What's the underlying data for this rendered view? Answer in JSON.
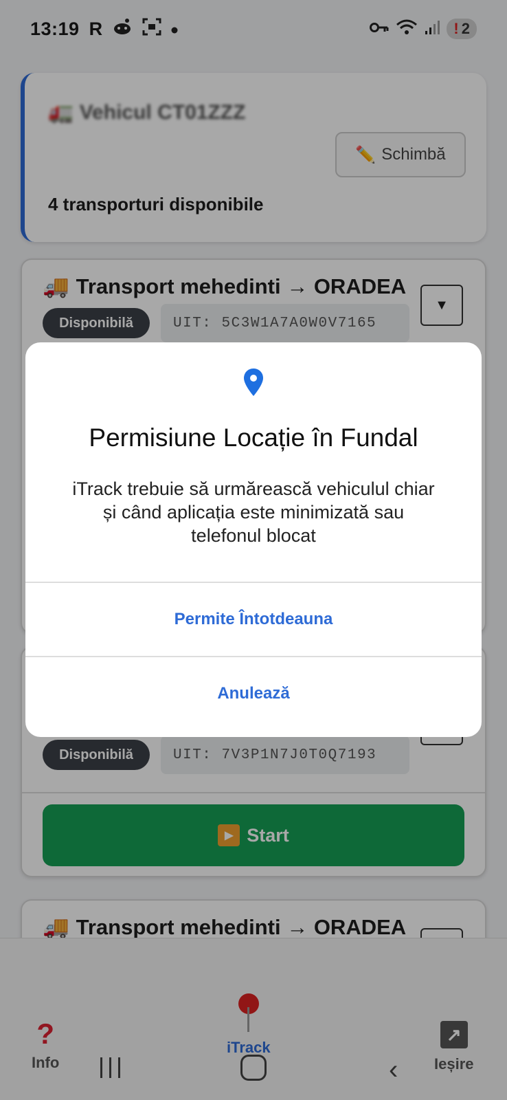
{
  "status_bar": {
    "time": "13:19",
    "app_letter": "R",
    "badge_count": "2",
    "left_icons": [
      "reddit-icon",
      "screenshot-icon",
      "dot-icon"
    ],
    "right_icons": [
      "vpn-key-icon",
      "wifi-icon",
      "signal-icon"
    ]
  },
  "vehicle": {
    "title": "Vehicul CT01ZZZ",
    "title_icon": "truck-icon",
    "change_label": "Schimbă",
    "available_text": "4 transporturi disponibile"
  },
  "transports": [
    {
      "title": "Transport mehedinti → ORADEA",
      "status": "Disponibilă",
      "uit": "UIT: 5C3W1A7A0W0V7165"
    },
    {
      "title": "",
      "status": "Disponibilă",
      "uit": "UIT: 7V3P1N7J0T0Q7193",
      "start_label": "Start"
    },
    {
      "title": "Transport mehedinti → ORADEA"
    }
  ],
  "bottom_nav": {
    "info_label": "Info",
    "itrack_label": "iTrack",
    "exit_label": "Ieșire"
  },
  "dialog": {
    "title": "Permisiune Locație în Fundal",
    "body": "iTrack trebuie să urmărească vehiculul chiar și când aplicația este minimizată sau telefonul blocat",
    "allow_label": "Permite Întotdeauna",
    "cancel_label": "Anulează",
    "accent_color": "#2e6bd6"
  }
}
